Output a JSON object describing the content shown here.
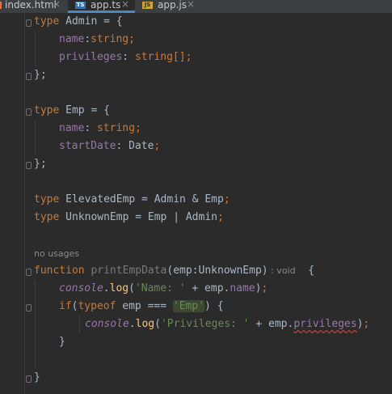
{
  "tabs": [
    {
      "label": "index.html",
      "icon": "html-file-icon",
      "active": false
    },
    {
      "label": "app.ts",
      "icon": "ts-file-icon",
      "badge": "TS",
      "active": true
    },
    {
      "label": "app.js",
      "icon": "js-file-icon",
      "badge": "JS",
      "active": false
    }
  ],
  "tab_close_glyph": "×",
  "code": {
    "l1": {
      "kw": "type",
      "name": " Admin = {"
    },
    "l2": {
      "prop": "name",
      "rest_a": ":",
      "type": "string",
      "end": ";"
    },
    "l3": {
      "prop": "privileges",
      "rest_a": ": ",
      "type": "string[]",
      "end": ";"
    },
    "l4": {
      "text": "};"
    },
    "l6": {
      "kw": "type",
      "name": " Emp = {"
    },
    "l7": {
      "prop": "name",
      "rest_a": ": ",
      "type": "string",
      "end": ";"
    },
    "l8": {
      "prop": "startDate",
      "rest_a": ": ",
      "type": "Date",
      "end": ";"
    },
    "l9": {
      "text": "};"
    },
    "l11": {
      "kw": "type",
      "rest": " ElevatedEmp = Admin & Emp",
      "end": ";"
    },
    "l12": {
      "kw": "type",
      "rest": " UnknownEmp = Emp | Admin",
      "end": ";"
    },
    "usages": "no usages",
    "l14": {
      "kw": "function",
      "fn": " printEmpData",
      "params": "(emp:UnknownEmp)",
      "hint": " : void",
      "brace": "  {"
    },
    "l15": {
      "con": "console",
      "dot": ".",
      "fn": "log",
      "open": "(",
      "str": "'Name: '",
      "rest": " + emp.",
      "prop": "name",
      "close": ")",
      "end": ";"
    },
    "l16": {
      "kw": "if",
      "open": "(",
      "kw2": "typeof",
      "rest": " emp === ",
      "str": "'Emp'",
      "close": ") {"
    },
    "l17": {
      "con": "console",
      "dot": ".",
      "fn": "log",
      "open": "(",
      "str": "'Privileges: '",
      "rest": " + emp.",
      "prop": "privileges",
      "close": ")",
      "end": ";"
    },
    "l18": {
      "text": "}"
    },
    "l20": {
      "text": "}"
    }
  },
  "colors": {
    "background": "#2b2b2b",
    "keyword": "#cc7832",
    "property": "#9876aa",
    "string": "#6a8759",
    "function": "#ffc66d",
    "text": "#a9b7c6",
    "accent": "#4a88c7"
  }
}
